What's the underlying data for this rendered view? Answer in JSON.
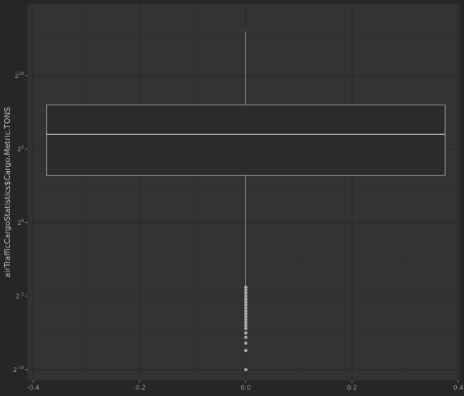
{
  "chart_data": {
    "type": "boxplot",
    "title": "",
    "xlabel": "",
    "ylabel": "airTrafficCargoStatistics$Cargo.Metric.TONS",
    "y_scale": "log2",
    "xlim": [
      -0.4,
      0.4
    ],
    "ylim_log2": [
      -10,
      13
    ],
    "x_ticks": [
      {
        "value": -0.4,
        "label": "-0.4"
      },
      {
        "value": -0.2,
        "label": "-0.2"
      },
      {
        "value": 0.0,
        "label": "0.0"
      },
      {
        "value": 0.2,
        "label": "0.2"
      },
      {
        "value": 0.4,
        "label": "0.4"
      }
    ],
    "y_ticks": [
      {
        "exp": 10,
        "base": "2",
        "sup": "10"
      },
      {
        "exp": 5,
        "base": "2",
        "sup": "5"
      },
      {
        "exp": 0,
        "base": "2",
        "sup": "0"
      },
      {
        "exp": -5,
        "base": "2",
        "sup": "-5"
      },
      {
        "exp": -10,
        "base": "2",
        "sup": "-10"
      }
    ],
    "box": {
      "x_center": 0.0,
      "x_from": -0.375,
      "x_to": 0.375,
      "q1_log2": 3.2,
      "median_log2": 6.0,
      "q3_log2": 8.0,
      "whisker_low_log2": -4.3,
      "whisker_high_log2": 13.0
    },
    "outliers_log2": [
      -4.4,
      -4.6,
      -4.8,
      -5.0,
      -5.2,
      -5.4,
      -5.6,
      -5.8,
      -6.0,
      -6.2,
      -6.4,
      -6.6,
      -6.8,
      -7.0,
      -7.2,
      -7.5,
      -7.8,
      -8.2,
      -8.7,
      -10.0
    ],
    "grid": true,
    "colors": {
      "plot_background": "#333333",
      "page_background": "#262626",
      "grid_major": "#262626",
      "grid_minor": "#2d2d2d",
      "box_fill": "#2b2b2b",
      "box_line": "#a6a6a6",
      "outlier": "#a6a6a6",
      "tick_text": "#9a9a9a",
      "axis_title": "#bdbdbd"
    }
  }
}
